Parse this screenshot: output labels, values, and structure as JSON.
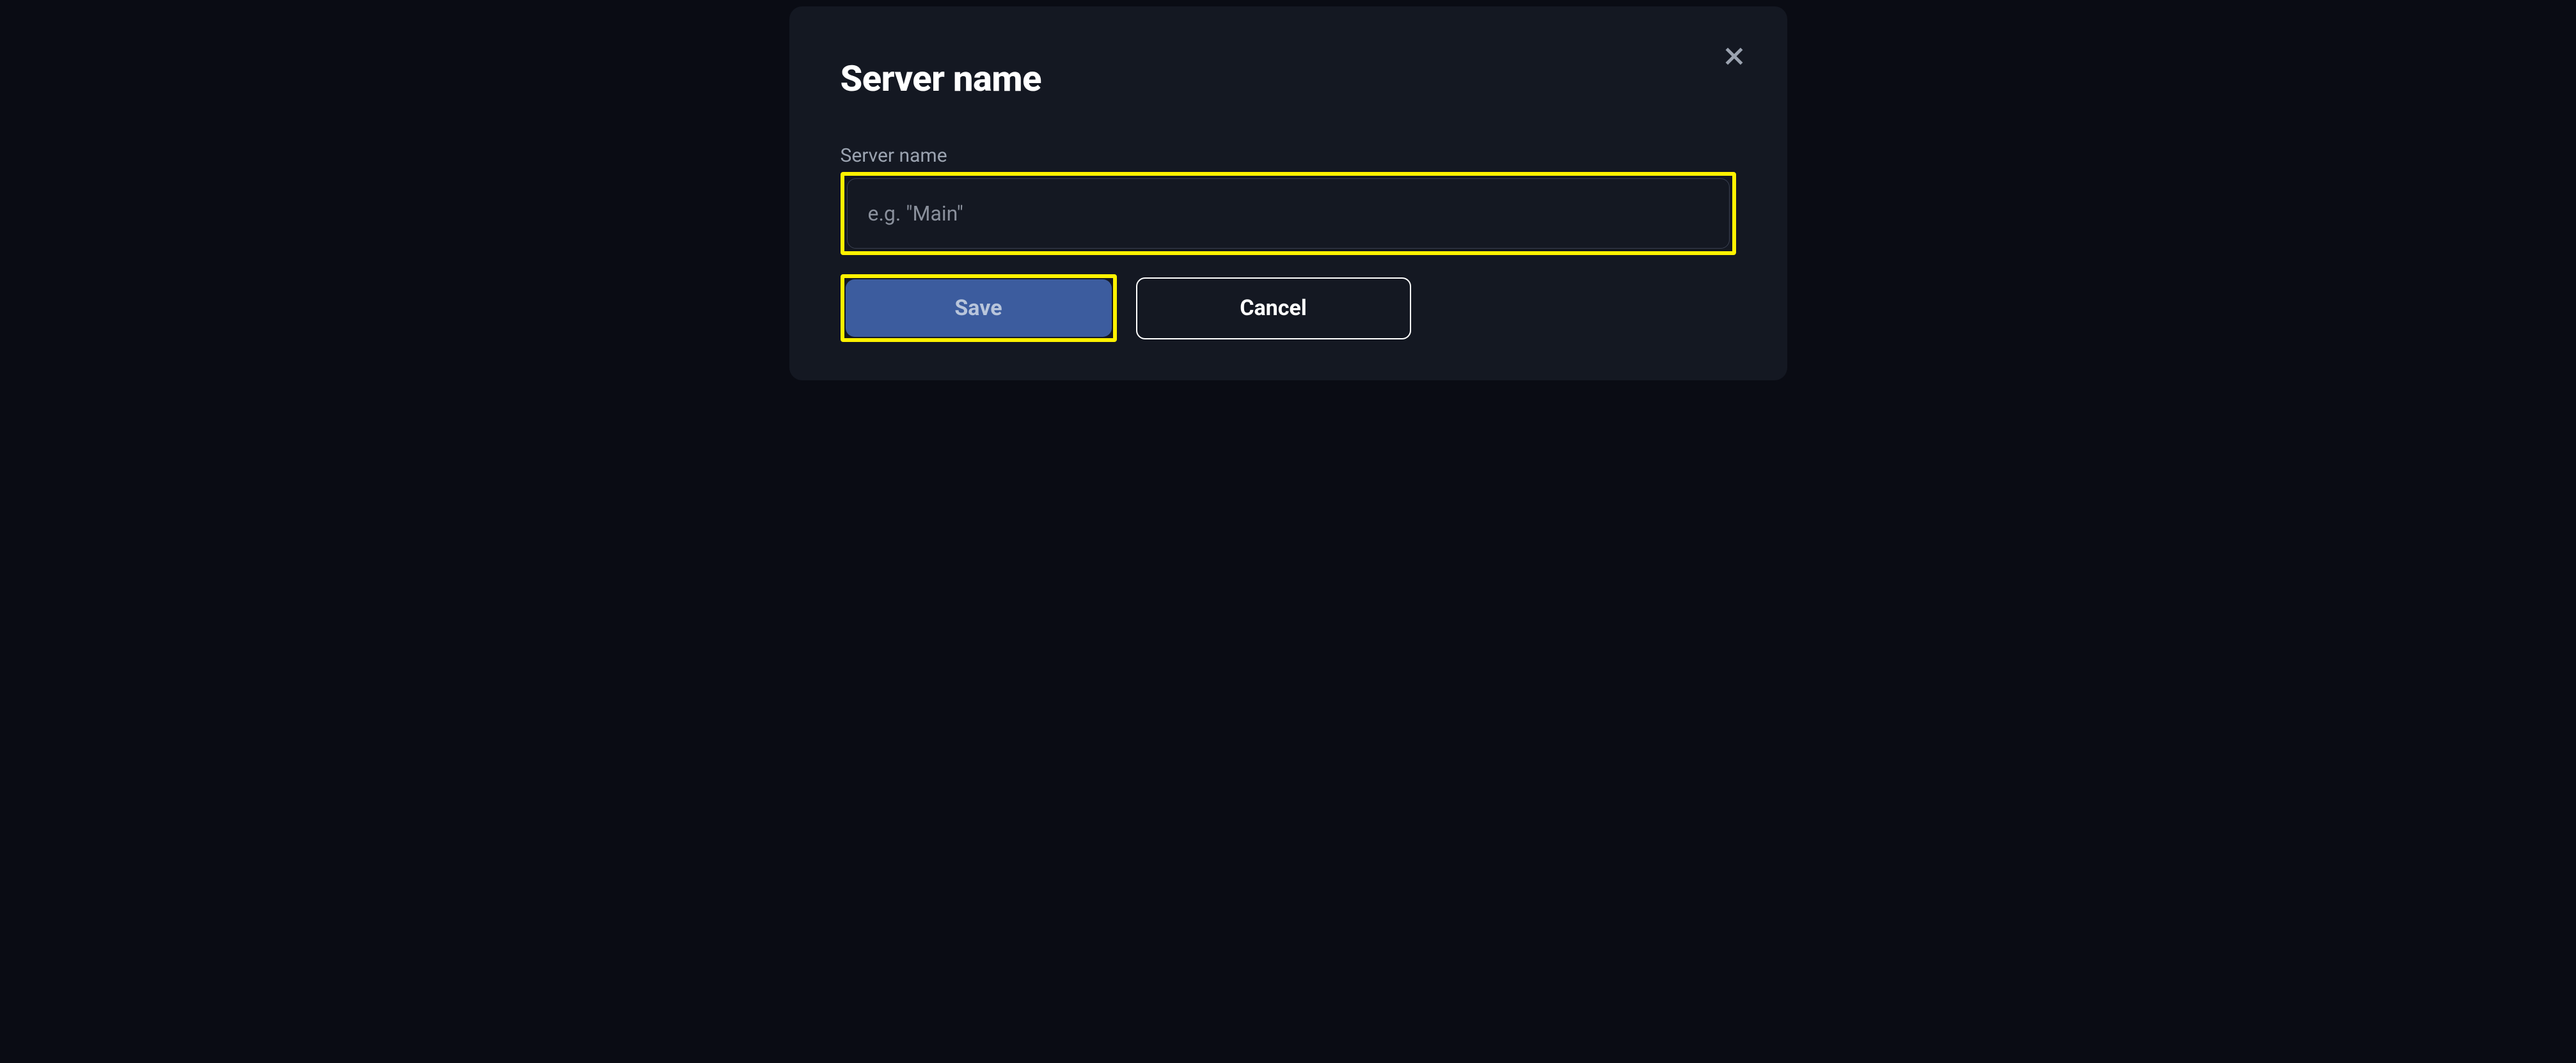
{
  "modal": {
    "title": "Server name",
    "close_icon": "close-icon"
  },
  "form": {
    "field_label": "Server name",
    "input_value": "",
    "input_placeholder": "e.g. \"Main\""
  },
  "buttons": {
    "save_label": "Save",
    "cancel_label": "Cancel"
  },
  "colors": {
    "background": "#0a0c14",
    "modal_bg": "#141822",
    "highlight": "#fff200",
    "primary_button": "#3c5c9e",
    "text_primary": "#ffffff",
    "text_secondary": "#9ba3b0"
  }
}
